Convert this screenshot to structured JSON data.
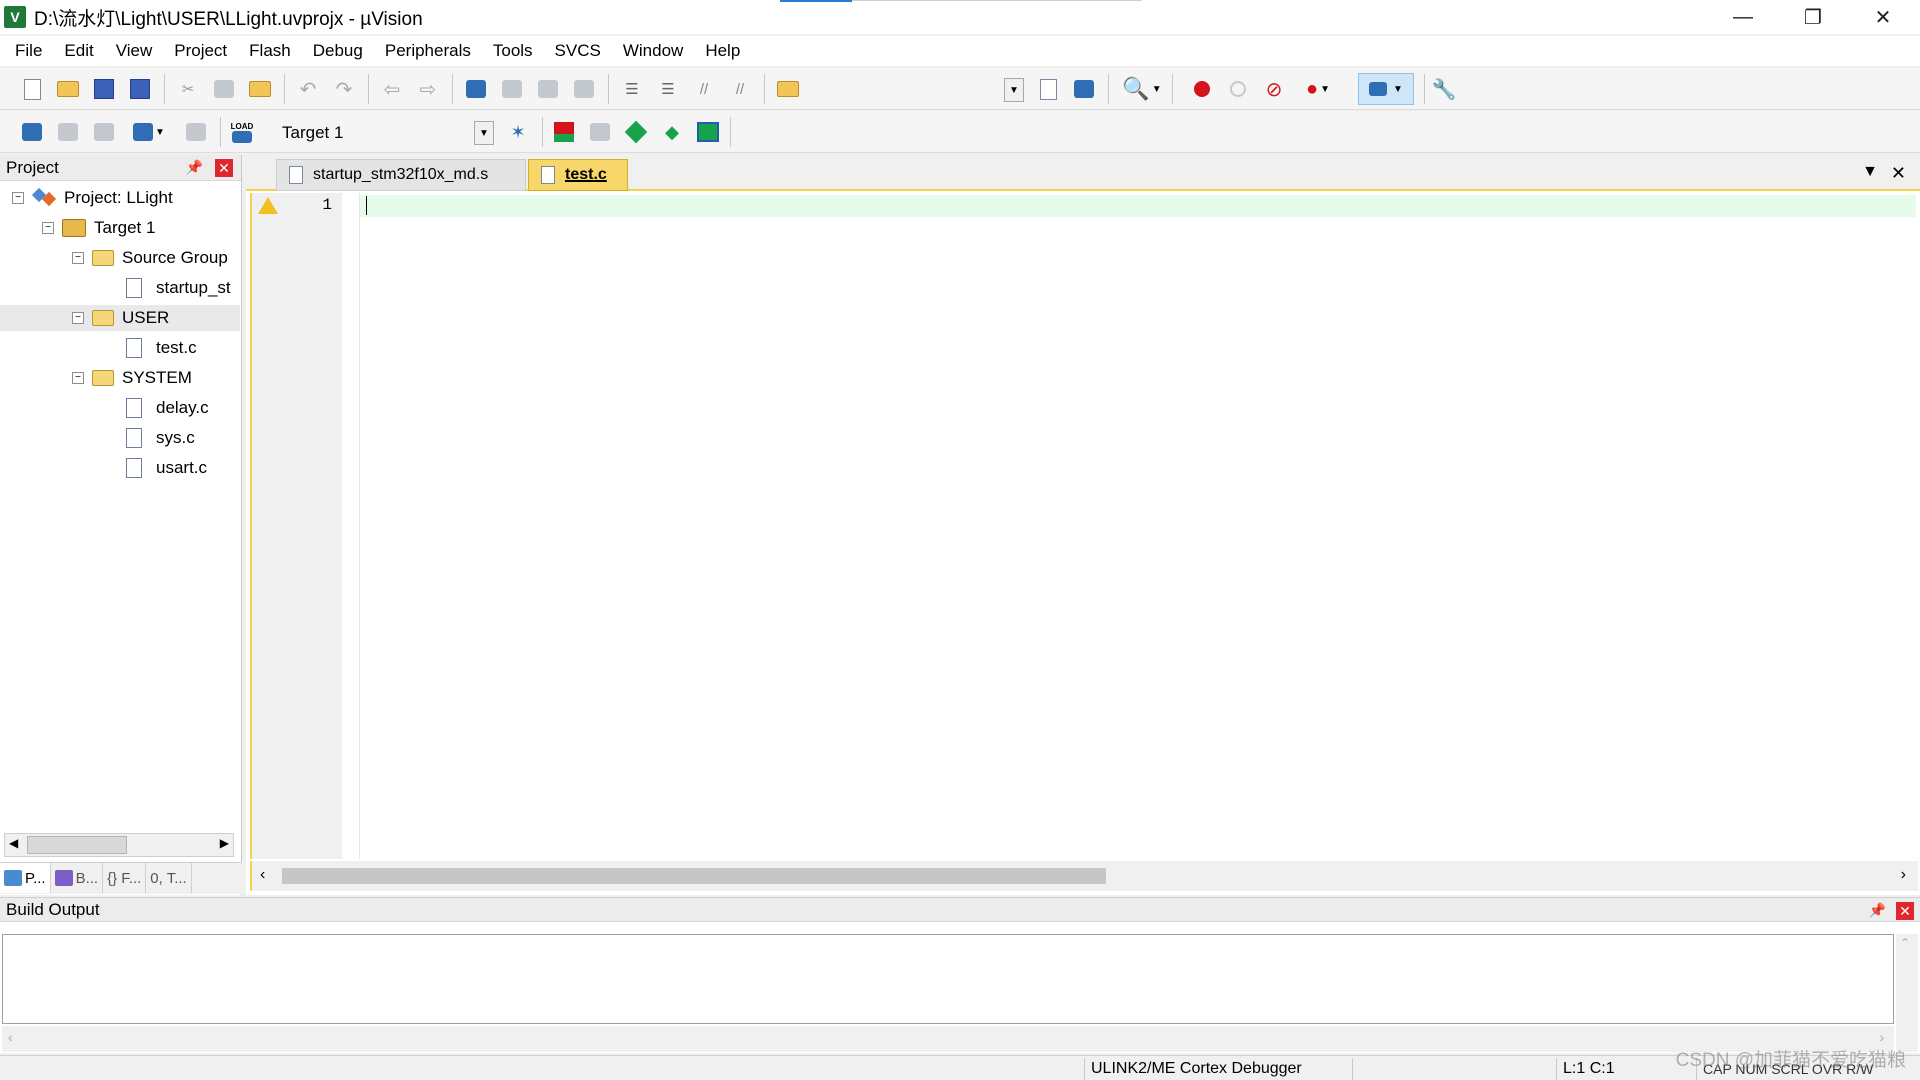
{
  "window": {
    "title": "D:\\流水灯\\Light\\USER\\LLight.uvprojx - µVision",
    "icon_label": "V",
    "controls": {
      "minimize": "—",
      "restore": "❐",
      "close": "✕"
    }
  },
  "menu": [
    "File",
    "Edit",
    "View",
    "Project",
    "Flash",
    "Debug",
    "Peripherals",
    "Tools",
    "SVCS",
    "Window",
    "Help"
  ],
  "toolbar2": {
    "target_value": "Target 1",
    "load_label": "LOAD"
  },
  "project_pane": {
    "title": "Project",
    "tree": {
      "project": "Project: LLight",
      "target": "Target 1",
      "groups": [
        {
          "name": "Source Group",
          "files": [
            "startup_st"
          ]
        },
        {
          "name": "USER",
          "files": [
            "test.c"
          ]
        },
        {
          "name": "SYSTEM",
          "files": [
            "delay.c",
            "sys.c",
            "usart.c"
          ]
        }
      ]
    },
    "tabs": [
      "P...",
      "B...",
      "{} F...",
      "0, T..."
    ]
  },
  "editor": {
    "tabs": [
      {
        "label": "startup_stm32f10x_md.s",
        "active": false
      },
      {
        "label": "test.c",
        "active": true
      }
    ],
    "line_numbers": [
      "1"
    ]
  },
  "build_output": {
    "title": "Build Output"
  },
  "status": {
    "debugger": "ULINK2/ME Cortex Debugger",
    "position": "L:1 C:1",
    "indicators": "CAP NUM SCRL OVR R/W"
  },
  "watermark": "CSDN @加菲猫不爱吃猫粮",
  "colors": {
    "active_tab": "#f7d76a",
    "current_line": "#e6fbe9",
    "close_red": "#e0272e",
    "breakpoint_red": "#d4141c"
  }
}
